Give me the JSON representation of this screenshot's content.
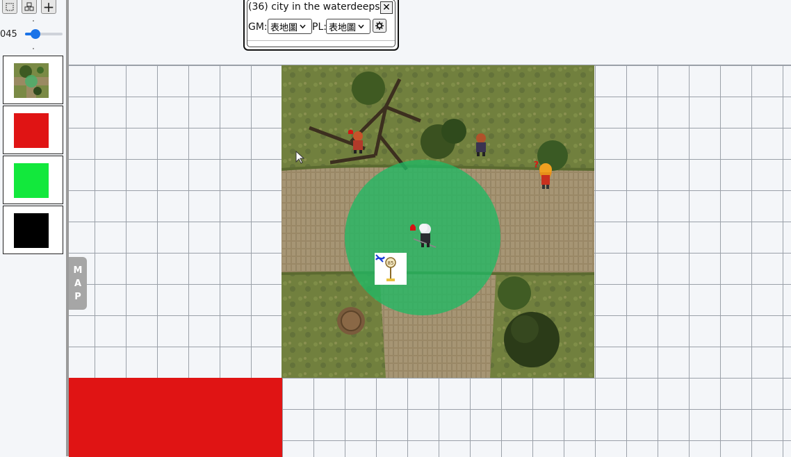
{
  "toolbar": {
    "icons": [
      "select-area-icon",
      "multi-select-icon",
      "add-icon"
    ],
    "add_label": "+",
    "zoom_value": "045",
    "zoom_level": 0.2
  },
  "swatches": [
    {
      "kind": "map-thumbnail"
    },
    {
      "kind": "color",
      "color": "#e01414"
    },
    {
      "kind": "color",
      "color": "#12e83c"
    },
    {
      "kind": "color",
      "color": "#000000"
    }
  ],
  "map_tab": {
    "letters": [
      "M",
      "A",
      "P"
    ]
  },
  "room_panel": {
    "title": "(36)  city in the waterdeeps",
    "close_label": "✕",
    "gm_label": "GM:",
    "gm_value": "表地圖",
    "pl_label": "PL:",
    "pl_value": "表地圖",
    "settings_icon": "gear-icon"
  },
  "board": {
    "aura_color": "#20b964",
    "block_color": "#e01414"
  }
}
